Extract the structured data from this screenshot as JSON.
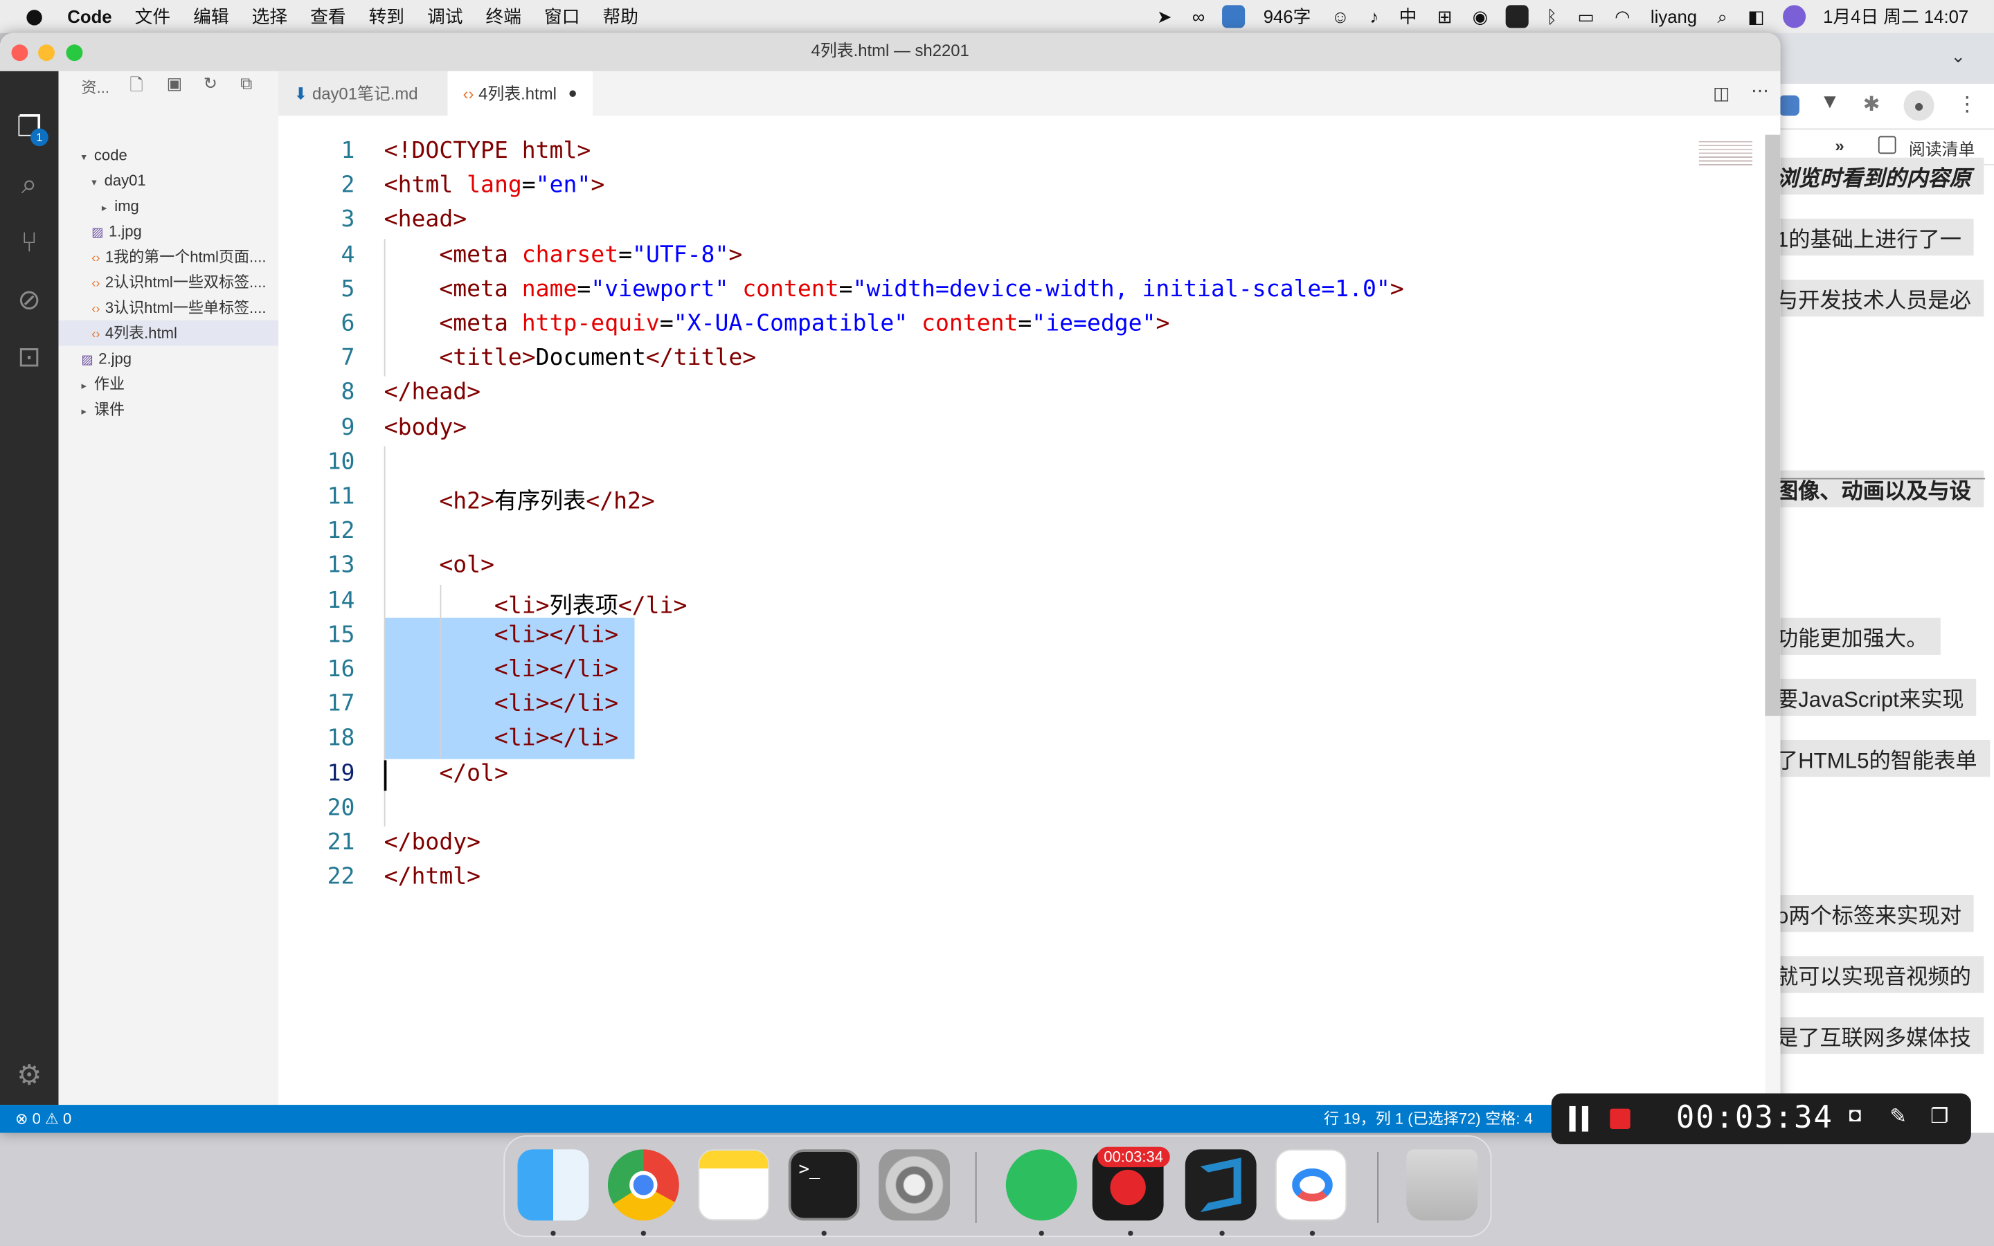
{
  "menubar": {
    "app": "Code",
    "items": [
      "文件",
      "编辑",
      "选择",
      "查看",
      "转到",
      "调试",
      "终端",
      "窗口",
      "帮助"
    ],
    "word_count": "946字",
    "input_method": "中",
    "user": "liyang",
    "datetime": "1月4日 周二  14:07"
  },
  "window": {
    "title": "4列表.html — sh2201"
  },
  "activity": {
    "badge": "1"
  },
  "sidebar": {
    "header": "资...",
    "tree": [
      {
        "label": "code",
        "twisty": "▾"
      },
      {
        "label": "day01",
        "twisty": "▾"
      },
      {
        "label": "img",
        "twisty": "▸"
      },
      {
        "label": "1.jpg",
        "icon": "image"
      },
      {
        "label": "1我的第一个html页面....",
        "icon": "html"
      },
      {
        "label": "2认识html一些双标签....",
        "icon": "html"
      },
      {
        "label": "3认识html一些单标签....",
        "icon": "html"
      },
      {
        "label": "4列表.html",
        "icon": "html"
      },
      {
        "label": "2.jpg",
        "icon": "image"
      },
      {
        "label": "作业",
        "twisty": "▸"
      },
      {
        "label": "课件",
        "twisty": "▸"
      }
    ]
  },
  "tabs": [
    {
      "label": "day01笔记.md",
      "icon": "markdown"
    },
    {
      "label": "4列表.html",
      "icon": "html",
      "active": true,
      "modified": true
    }
  ],
  "editor": {
    "current_line": 19,
    "lines": [
      "<!DOCTYPE html>",
      "<html lang=\"en\">",
      "<head>",
      "    <meta charset=\"UTF-8\">",
      "    <meta name=\"viewport\" content=\"width=device-width, initial-scale=1.0\">",
      "    <meta http-equiv=\"X-UA-Compatible\" content=\"ie=edge\">",
      "    <title>Document</title>",
      "</head>",
      "<body>",
      "",
      "    <h2>有序列表</h2>",
      "",
      "    <ol>",
      "        <li>列表项</li>",
      "        <li></li>",
      "        <li></li>",
      "        <li></li>",
      "        <li></li>",
      "    </ol>",
      "",
      "</body>",
      "</html>"
    ]
  },
  "statusbar": {
    "errors": "0",
    "warnings": "0",
    "position": "行 19，列 1 (已选择72)",
    "spaces": "空格: 4"
  },
  "browser": {
    "reading_list": "阅读清单",
    "overflow": "»",
    "lines": [
      "浏览时看到的内容原",
      "1的基础上进行了一",
      "与开发技术人员是必",
      "图像、动画以及与设",
      "功能更加强大。",
      "要JavaScript来实现",
      "了HTML5的智能表单",
      "o两个标签来实现对",
      "就可以实现音视频的",
      "是了互联网多媒体技"
    ]
  },
  "recorder": {
    "time": "00:03:34"
  },
  "dock": {
    "recording_badge": "00:03:34"
  },
  "colors": {
    "statusbar": "#007acc",
    "activitybar": "#2c2c2c",
    "selection": "#add6ff",
    "tag": "#800000",
    "attribute": "#e50000",
    "value": "#0000ff",
    "line_number": "#237893"
  }
}
